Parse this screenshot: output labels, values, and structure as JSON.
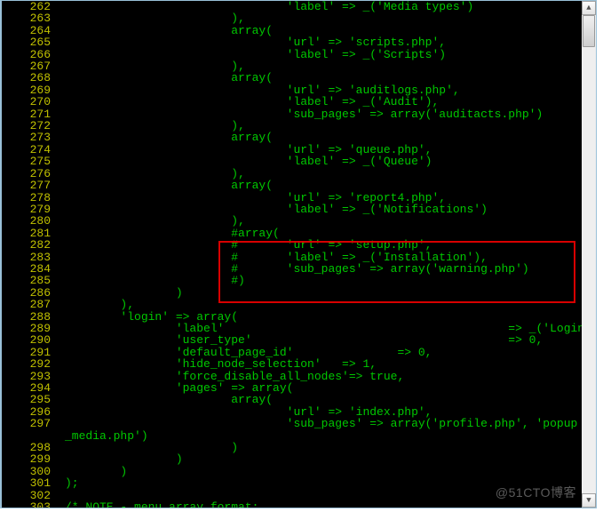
{
  "watermark": "@51CTO博客",
  "scroll": {
    "up": "▲",
    "down": "▼"
  },
  "lines": [
    {
      "n": "262",
      "t": "                                'label' => _('Media types')"
    },
    {
      "n": "263",
      "t": "                        ),"
    },
    {
      "n": "264",
      "t": "                        array("
    },
    {
      "n": "265",
      "t": "                                'url' => 'scripts.php',"
    },
    {
      "n": "266",
      "t": "                                'label' => _('Scripts')"
    },
    {
      "n": "267",
      "t": "                        ),"
    },
    {
      "n": "268",
      "t": "                        array("
    },
    {
      "n": "269",
      "t": "                                'url' => 'auditlogs.php',"
    },
    {
      "n": "270",
      "t": "                                'label' => _('Audit'),"
    },
    {
      "n": "271",
      "t": "                                'sub_pages' => array('auditacts.php')"
    },
    {
      "n": "272",
      "t": "                        ),"
    },
    {
      "n": "273",
      "t": "                        array("
    },
    {
      "n": "274",
      "t": "                                'url' => 'queue.php',"
    },
    {
      "n": "275",
      "t": "                                'label' => _('Queue')"
    },
    {
      "n": "276",
      "t": "                        ),"
    },
    {
      "n": "277",
      "t": "                        array("
    },
    {
      "n": "278",
      "t": "                                'url' => 'report4.php',"
    },
    {
      "n": "279",
      "t": "                                'label' => _('Notifications')"
    },
    {
      "n": "280",
      "t": "                        ),"
    },
    {
      "n": "281",
      "t": "                        #array("
    },
    {
      "n": "282",
      "t": "                        #       'url' => 'setup.php',"
    },
    {
      "n": "283",
      "t": "                        #       'label' => _('Installation'),"
    },
    {
      "n": "284",
      "t": "                        #       'sub_pages' => array('warning.php')"
    },
    {
      "n": "285",
      "t": "                        #)"
    },
    {
      "n": "286",
      "t": "                )"
    },
    {
      "n": "287",
      "t": "        ),"
    },
    {
      "n": "288",
      "t": "        'login' => array("
    },
    {
      "n": "289",
      "t": "                'label'                                         => _('Login'),"
    },
    {
      "n": "290",
      "t": "                'user_type'                                     => 0,"
    },
    {
      "n": "291",
      "t": "                'default_page_id'               => 0,"
    },
    {
      "n": "292",
      "t": "                'hide_node_selection'   => 1,"
    },
    {
      "n": "293",
      "t": "                'force_disable_all_nodes'=> true,"
    },
    {
      "n": "294",
      "t": "                'pages' => array("
    },
    {
      "n": "295",
      "t": "                        array("
    },
    {
      "n": "296",
      "t": "                                'url' => 'index.php',"
    },
    {
      "n": "297",
      "t": "                                'sub_pages' => array('profile.php', 'popup"
    },
    {
      "n": "",
      "t": "_media.php')"
    },
    {
      "n": "298",
      "t": "                        )"
    },
    {
      "n": "299",
      "t": "                )"
    },
    {
      "n": "300",
      "t": "        )"
    },
    {
      "n": "301",
      "t": ");"
    },
    {
      "n": "302",
      "t": ""
    },
    {
      "n": "303",
      "t": "/* NOTE - menu array format:"
    }
  ]
}
